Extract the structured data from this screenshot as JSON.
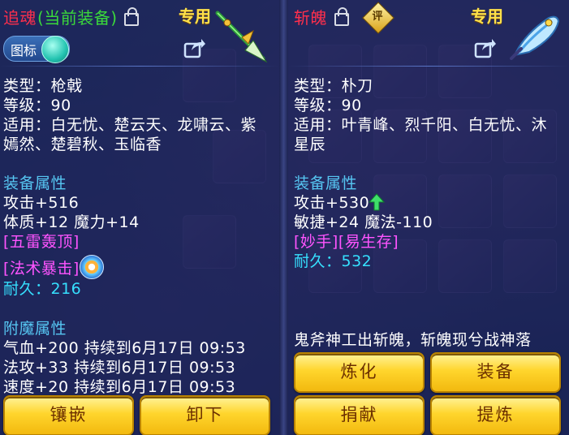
{
  "colors": {
    "title_red": "#ff2f4c",
    "equipped_green": "#3bd93b",
    "section_blue": "#56c6f2",
    "special_pink": "#ff54ff",
    "durability_cyan": "#36e0ff",
    "exclusive_gold": "#ffe14a",
    "button_gold": "#ffd52c"
  },
  "left": {
    "name": "追魂",
    "status": "(当前装备)",
    "exclusive": "专用",
    "icon_toggle_label": "图标",
    "type": "类型：枪戟",
    "level": "等级：90",
    "suitable_line1": "适用：白无忧、楚云天、龙啸云、紫",
    "suitable_line2": "嫣然、楚碧秋、玉临香",
    "attr_title": "装备属性",
    "attack": "攻击+516",
    "stats": "体质+12 魔力+14",
    "special1": "[五雷轰顶]",
    "special2": "[法术暴击]",
    "durability": "耐久：216",
    "enchant_title": "附魔属性",
    "enchant1": "气血+200 持续到6月17日 09:53",
    "enchant2": "法攻+33 持续到6月17日 09:53",
    "enchant3": "速度+20 持续到6月17日 09:53",
    "btn_inlay": "镶嵌",
    "btn_unequip": "卸下"
  },
  "right": {
    "name": "斩魄",
    "rating_badge": "评",
    "exclusive": "专用",
    "type": "类型：朴刀",
    "level": "等级：90",
    "suitable_line1": "适用：叶青峰、烈千阳、白无忧、沐",
    "suitable_line2": "星辰",
    "attr_title": "装备属性",
    "attack": "攻击+530",
    "stats": "敏捷+24 魔法-110",
    "special": "[妙手][易生存]",
    "durability": "耐久：532",
    "description": "鬼斧神工出斩魄，斩魄现兮战神落",
    "btn_refine": "炼化",
    "btn_equip": "装备",
    "btn_donate": "捐献",
    "btn_extract": "提炼"
  },
  "icons": [
    "lock-icon",
    "share-icon",
    "spear-weapon-icon",
    "blade-weapon-icon",
    "rating-badge-icon",
    "upgrade-arrow-icon",
    "skill-swirl-icon"
  ]
}
